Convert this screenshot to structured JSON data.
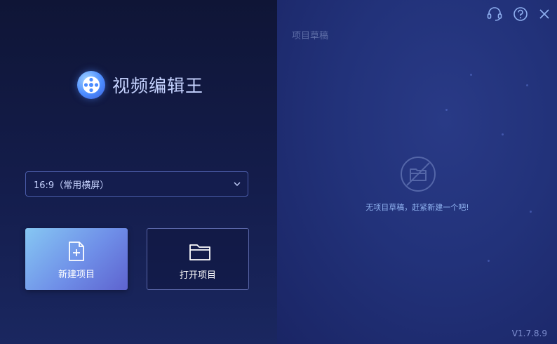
{
  "app": {
    "name": "视频编辑王",
    "version": "V1.7.8.9"
  },
  "header": {
    "icons": [
      "headset-support-icon",
      "help-icon",
      "close-icon"
    ]
  },
  "left_panel": {
    "aspect_select": {
      "value": "16:9（常用横屏）"
    },
    "new_project_label": "新建项目",
    "open_project_label": "打开项目"
  },
  "right_panel": {
    "title": "项目草稿",
    "empty_message": "无项目草稿，赶紧新建一个吧!"
  },
  "colors": {
    "accent": "#6f8fe8",
    "background": "#141c46",
    "text_muted": "#5f6fa8"
  }
}
